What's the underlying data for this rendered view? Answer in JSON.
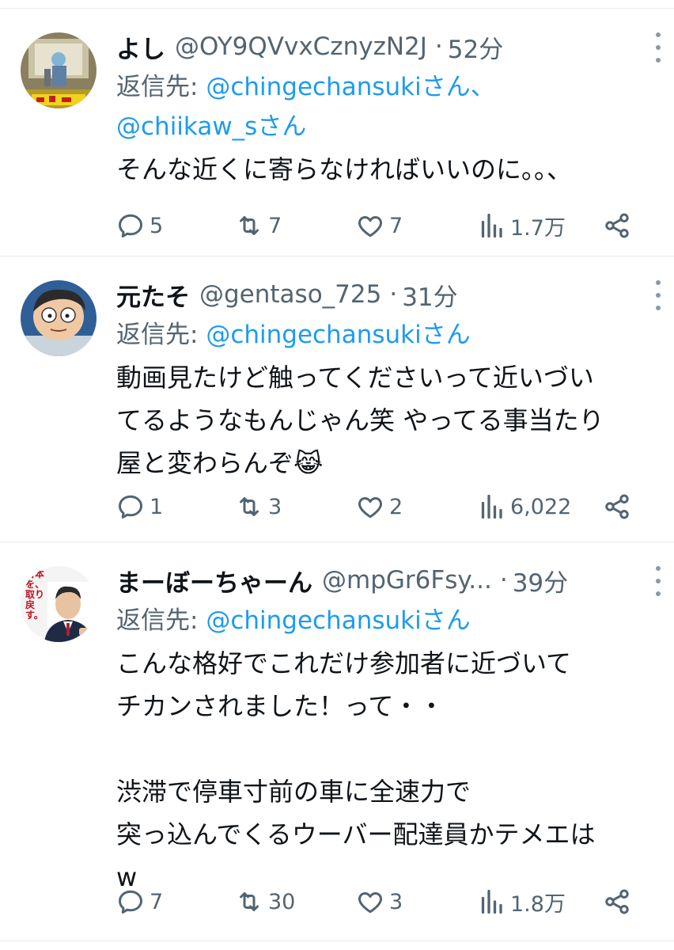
{
  "tweets": [
    {
      "display_name": "よし",
      "handle": "@OY9QVvxCznyzN2J",
      "separator": "·",
      "time": "52分",
      "reply_prefix": "返信先: ",
      "reply_mention_1": "@chingechansukiさん、",
      "reply_mention_2": "@chiikaw_sさん",
      "text": "そんな近くに寄らなければいいのに。。、",
      "replies": "5",
      "retweets": "7",
      "likes": "7",
      "views": "1.7万"
    },
    {
      "display_name": "元たそ",
      "handle": "@gentaso_725",
      "separator": "·",
      "time": "31分",
      "reply_prefix": "返信先: ",
      "reply_mention_1": "@chingechansukiさん",
      "text_line_1": "動画見たけど触ってくださいって近いづい",
      "text_line_2": "てるようなもんじゃん笑 やってる事当たり",
      "text_line_3": "屋と変わらんぞ",
      "emoji": "😹",
      "replies": "1",
      "retweets": "3",
      "likes": "2",
      "views": "6,022"
    },
    {
      "display_name": "まーぼーちゃーん",
      "handle": "@mpGr6Fsy...",
      "separator": "·",
      "time": "39分",
      "avatar_text": "日本を、取り戻す。",
      "reply_prefix": "返信先: ",
      "reply_mention_1": "@chingechansukiさん",
      "text": "こんな格好でこれだけ参加者に近づいて\nチカンされました！って・・\n\n渋滞で停車寸前の車に全速力で\n突っ込んでくるウーバー配達員かテメエは\nw",
      "replies": "7",
      "retweets": "30",
      "likes": "3",
      "views": "1.8万"
    }
  ],
  "icons": {
    "reply": "reply-icon",
    "retweet": "retweet-icon",
    "like": "heart-icon",
    "views": "views-icon",
    "share": "share-icon",
    "more": "more-options-icon"
  },
  "colors": {
    "text": "#0f1419",
    "secondary": "#536471",
    "link": "#1d9bf0",
    "divider": "#e7e9ea",
    "icon": "#536471"
  }
}
